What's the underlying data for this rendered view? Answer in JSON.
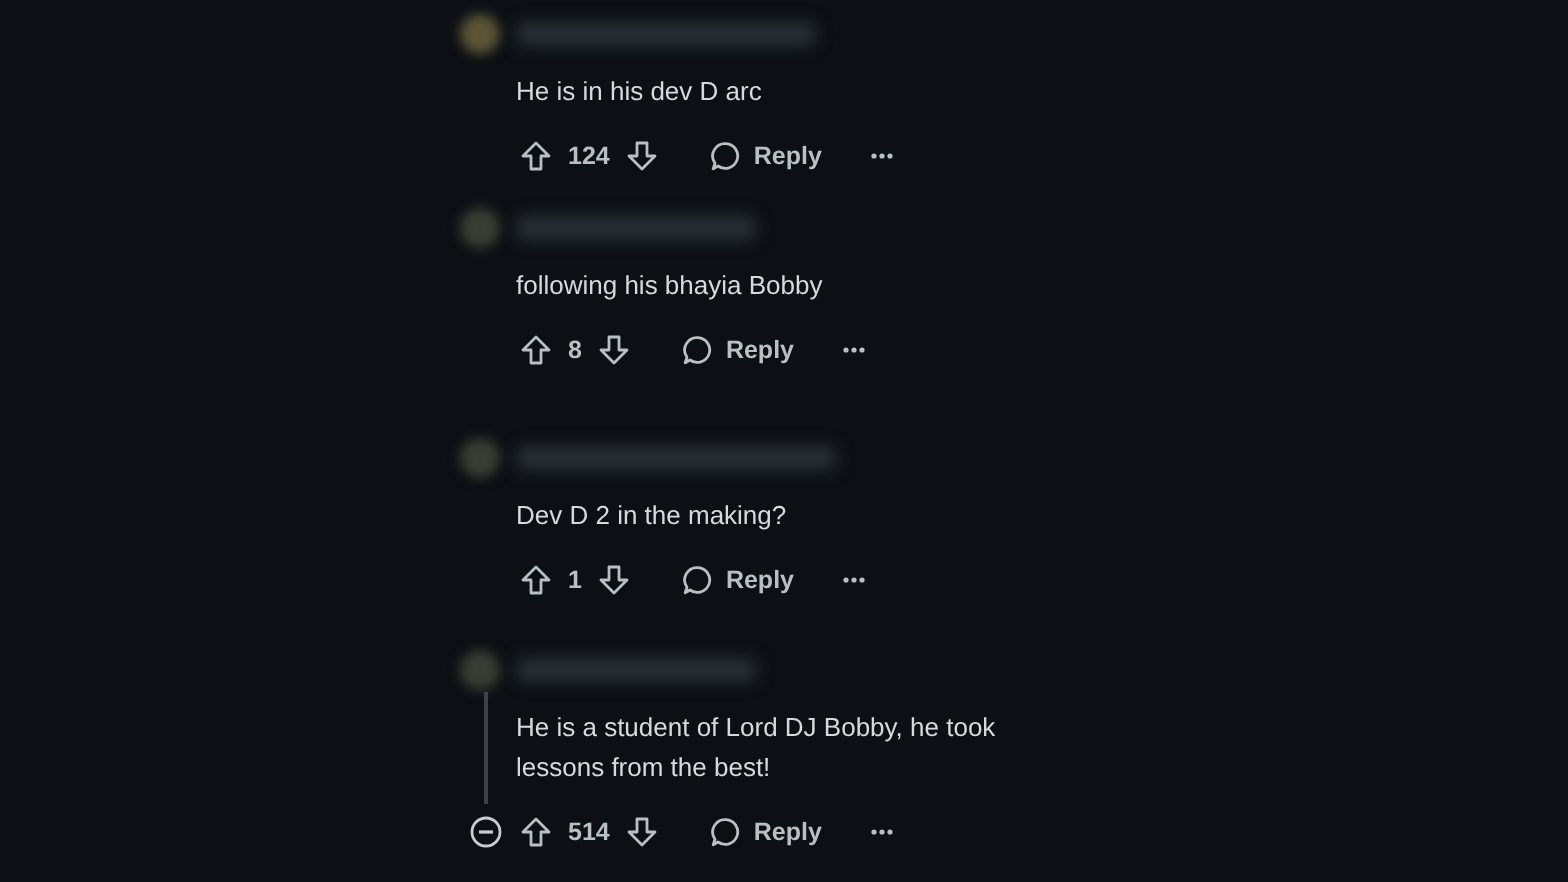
{
  "comments": [
    {
      "text": "He is in his dev D arc",
      "score": "124",
      "reply": "Reply",
      "collapsible": false
    },
    {
      "text": "following his bhayia Bobby",
      "score": "8",
      "reply": "Reply",
      "collapsible": false
    },
    {
      "text": "Dev D 2 in the making?",
      "score": "1",
      "reply": "Reply",
      "collapsible": false
    },
    {
      "text": "He is a student of Lord DJ Bobby, he took lessons from the best!",
      "score": "514",
      "reply": "Reply",
      "collapsible": true
    }
  ]
}
